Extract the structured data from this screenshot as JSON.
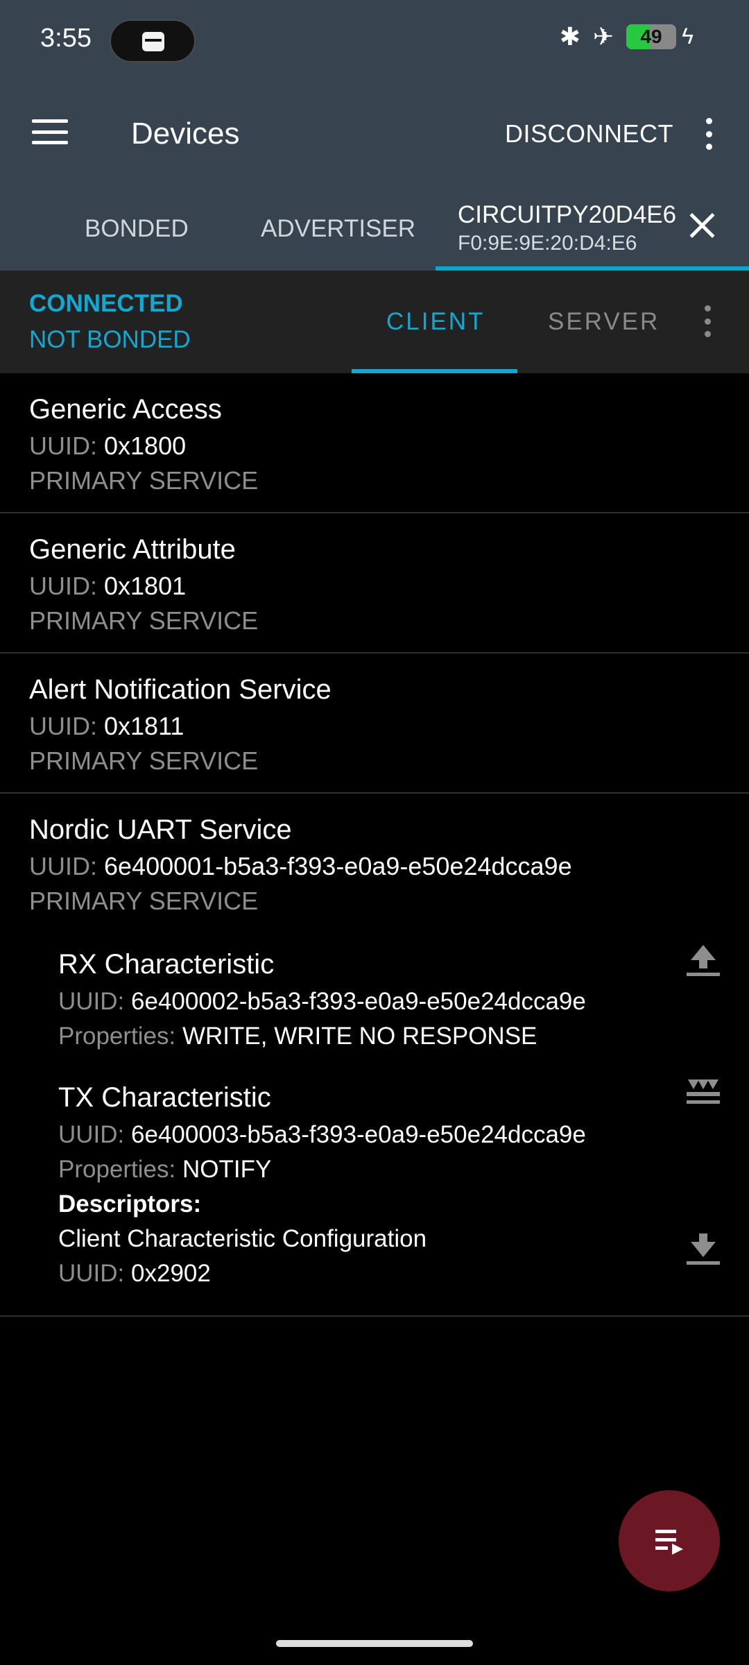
{
  "status_bar": {
    "time": "3:55",
    "battery_level": "49",
    "icons": [
      "wallet-icon",
      "bluetooth-icon",
      "airplane-icon",
      "battery-icon",
      "charging-icon"
    ]
  },
  "app_bar": {
    "title": "Devices",
    "disconnect_label": "DISCONNECT"
  },
  "device_tabs": {
    "bonded": "BONDED",
    "advertiser": "ADVERTISER",
    "active_name": "CIRCUITPY20D4E6",
    "active_address": "F0:9E:9E:20:D4:E6"
  },
  "connection": {
    "state": "CONNECTED",
    "bond_state": "NOT BONDED",
    "client_tab": "CLIENT",
    "server_tab": "SERVER"
  },
  "labels": {
    "uuid": "UUID:",
    "properties": "Properties:",
    "descriptors": "Descriptors:"
  },
  "services": [
    {
      "name": "Generic Access",
      "uuid": "0x1800",
      "type": "PRIMARY SERVICE"
    },
    {
      "name": "Generic Attribute",
      "uuid": "0x1801",
      "type": "PRIMARY SERVICE"
    },
    {
      "name": "Alert Notification Service",
      "uuid": "0x1811",
      "type": "PRIMARY SERVICE"
    },
    {
      "name": "Nordic UART Service",
      "uuid": "6e400001-b5a3-f393-e0a9-e50e24dcca9e",
      "type": "PRIMARY SERVICE",
      "characteristics": [
        {
          "name": "RX Characteristic",
          "uuid": "6e400002-b5a3-f393-e0a9-e50e24dcca9e",
          "properties": "WRITE, WRITE NO RESPONSE"
        },
        {
          "name": "TX Characteristic",
          "uuid": "6e400003-b5a3-f393-e0a9-e50e24dcca9e",
          "properties": "NOTIFY",
          "descriptors": [
            {
              "name": "Client Characteristic Configuration",
              "uuid": "0x2902"
            }
          ]
        }
      ]
    }
  ],
  "colors": {
    "header": "#37434f",
    "accent": "#11a9d4",
    "fab": "#6b1724"
  }
}
